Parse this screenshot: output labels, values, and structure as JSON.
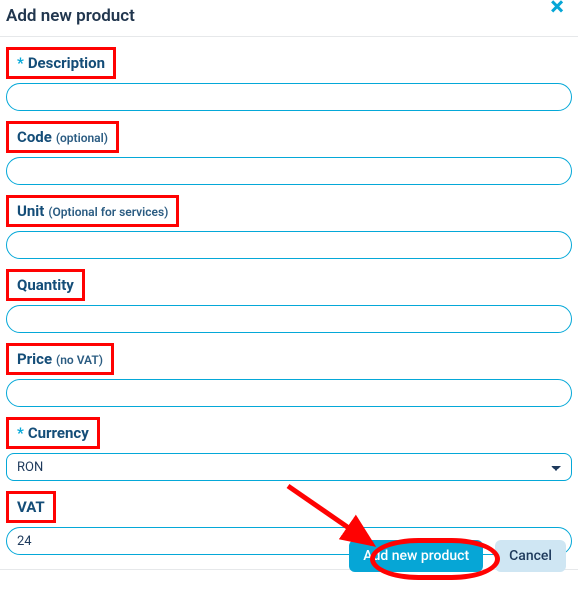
{
  "header": {
    "title": "Add new product"
  },
  "fields": {
    "description": {
      "label": "Description",
      "required": "*",
      "value": ""
    },
    "code": {
      "label": "Code",
      "suffix": "(optional)",
      "value": ""
    },
    "unit": {
      "label": "Unit",
      "suffix": "(Optional for services)",
      "value": ""
    },
    "quantity": {
      "label": "Quantity",
      "value": ""
    },
    "price": {
      "label": "Price",
      "suffix": "(no VAT)",
      "value": ""
    },
    "currency": {
      "label": "Currency",
      "required": "*",
      "value": "RON"
    },
    "vat": {
      "label": "VAT",
      "value": "24"
    }
  },
  "buttons": {
    "primary": "Add new product",
    "cancel": "Cancel"
  },
  "annotations": {
    "highlight_boxes": [
      "description",
      "code",
      "unit",
      "quantity",
      "price",
      "currency",
      "vat"
    ],
    "arrow_target": "add-new-product-button",
    "ellipse_target": "add-new-product-button"
  },
  "colors": {
    "highlight": "#ff0202",
    "primary": "#06a6d6",
    "input_border": "#05a8d8"
  }
}
